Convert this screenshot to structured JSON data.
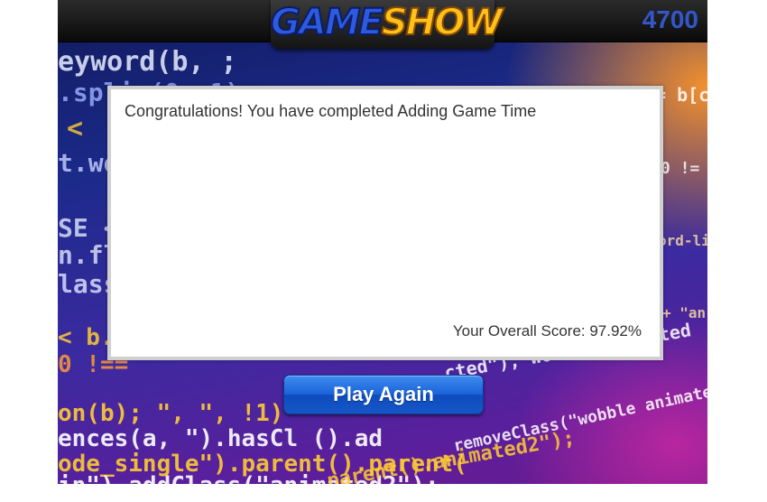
{
  "header": {
    "logo_part1": "GAME",
    "logo_part2": "SHOW",
    "score": "4700"
  },
  "dialog": {
    "message": "Congratulations! You have completed Adding Game Time",
    "overall_score_text": "Your Overall Score: 97.92%"
  },
  "actions": {
    "play_again_label": "Play Again"
  },
  "colors": {
    "score_text": "#3357c9",
    "logo_blue": "#2d5be0",
    "logo_gold": "#ffc21a",
    "button_blue": "#1a62d8"
  }
}
